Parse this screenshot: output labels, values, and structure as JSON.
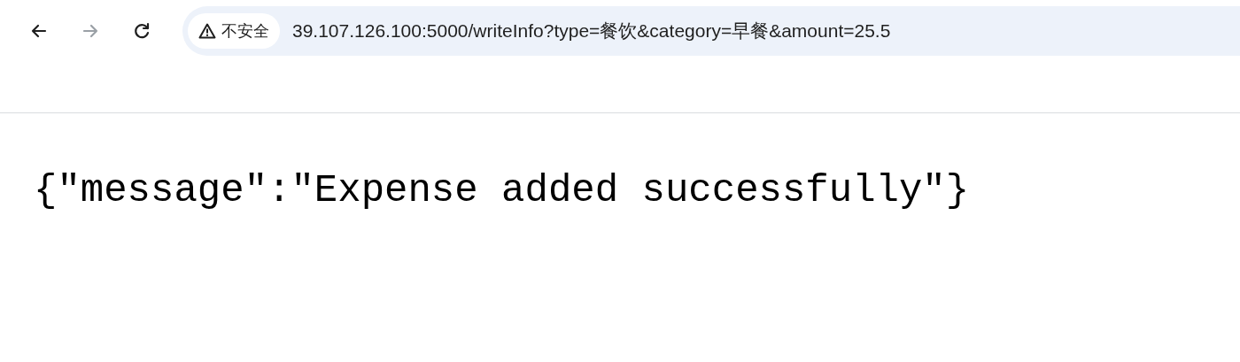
{
  "toolbar": {
    "nav_buttons": [
      {
        "kind": "back",
        "disabled": false
      },
      {
        "kind": "forward",
        "disabled": true
      },
      {
        "kind": "reload",
        "disabled": false
      }
    ],
    "security_chip": {
      "label": "不安全"
    },
    "address": "39.107.126.100:5000/writeInfo?type=餐饮&category=早餐&amount=25.5"
  },
  "body": {
    "text": "{\"message\":\"Expense added successfully\"}"
  }
}
